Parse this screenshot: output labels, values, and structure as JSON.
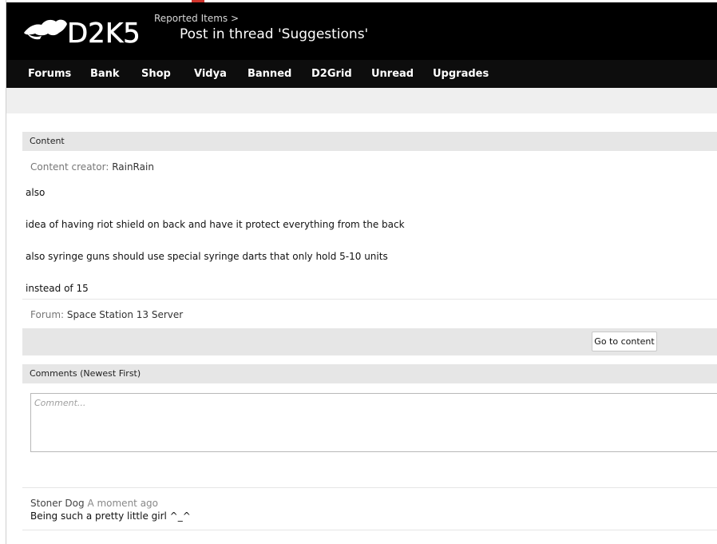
{
  "header": {
    "brand": "D2K5",
    "breadcrumb": "Reported Items >",
    "title": "Post in thread 'Suggestions'"
  },
  "nav": {
    "items": [
      {
        "label": "Forums"
      },
      {
        "label": "Bank"
      },
      {
        "label": "Shop"
      },
      {
        "label": "Vidya"
      },
      {
        "label": "Banned"
      },
      {
        "label": "D2Grid"
      },
      {
        "label": "Unread"
      },
      {
        "label": "Upgrades"
      }
    ]
  },
  "content": {
    "section_title": "Content",
    "creator_label": "Content creator:",
    "creator_value": "RainRain",
    "lines": [
      "also",
      "idea of having riot shield on back and have it protect everything from the back",
      "also syringe guns should use special syringe darts that only hold 5-10 units",
      "instead of 15"
    ],
    "forum_label": "Forum:",
    "forum_value": "Space Station 13 Server",
    "goto_label": "Go to content"
  },
  "comments": {
    "section_title": "Comments (Newest First)",
    "input_placeholder": "Comment...",
    "items": [
      {
        "author": "Stoner Dog",
        "time": "A moment ago",
        "text": "Being such a pretty little girl ^_^"
      }
    ]
  },
  "colors": {
    "header_bg": "#000000",
    "nav_bg": "#0d0d0d",
    "section_bg": "#e6e6e6"
  }
}
